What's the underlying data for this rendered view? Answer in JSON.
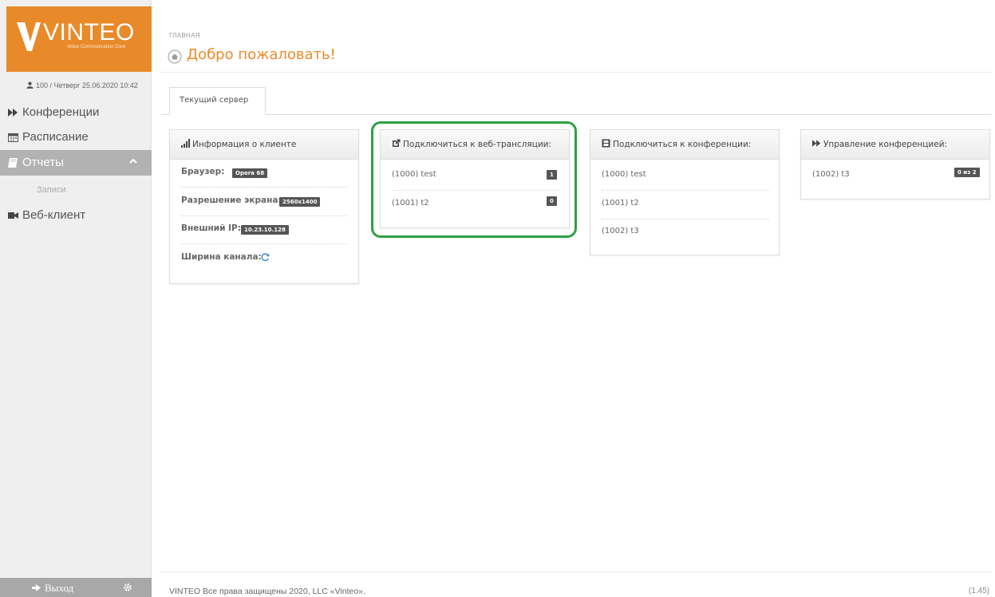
{
  "brand": {
    "name": "VINTEO",
    "tagline": "Video Communication Core",
    "accent": "#e98a2a"
  },
  "sidebar": {
    "user_info": "100 / Четверг 25.06.2020 10:42",
    "items": [
      {
        "label": "Конференции",
        "icon": "double-play-icon"
      },
      {
        "label": "Расписание",
        "icon": "calendar-icon"
      },
      {
        "label": "Отчеты",
        "icon": "book-icon",
        "active": true
      },
      {
        "label": "Веб-клиент",
        "icon": "video-camera-icon"
      }
    ],
    "subitem": "Записи",
    "logout_label": "Выход"
  },
  "header": {
    "breadcrumb": "ГЛАВНАЯ",
    "title": "Добро пожаловать!"
  },
  "tabs": [
    {
      "label": "Текущий сервер",
      "active": true
    }
  ],
  "client_info": {
    "title": "Информация о клиенте",
    "browser_label": "Браузер:",
    "browser_value": "Opera 68",
    "resolution_label": "Разрешение экрана:",
    "resolution_value": "2560x1400",
    "ip_label": "Внешний IP:",
    "ip_value": "10.23.10.128",
    "bandwidth_label": "Ширина канала:"
  },
  "webcast": {
    "title": "Подключиться к веб-трансляции:",
    "items": [
      {
        "name": "(1000) test",
        "count": "1"
      },
      {
        "name": "(1001) t2",
        "count": "0"
      }
    ]
  },
  "join_conf": {
    "title": "Подключиться к конференции:",
    "items": [
      "(1000) test",
      "(1001) t2",
      "(1002) t3"
    ]
  },
  "manage_conf": {
    "title": "Управление конференцией:",
    "items": [
      {
        "name": "(1002) t3",
        "count": "0 из 2"
      }
    ]
  },
  "footer": {
    "copyright": "VINTEO  Все права защищены 2020, LLC «Vinteo».",
    "version": "(1.45)"
  },
  "colors": {
    "highlight": "#2ea043",
    "badge": "#555555",
    "sidebar_active": "#b2b2b2"
  }
}
